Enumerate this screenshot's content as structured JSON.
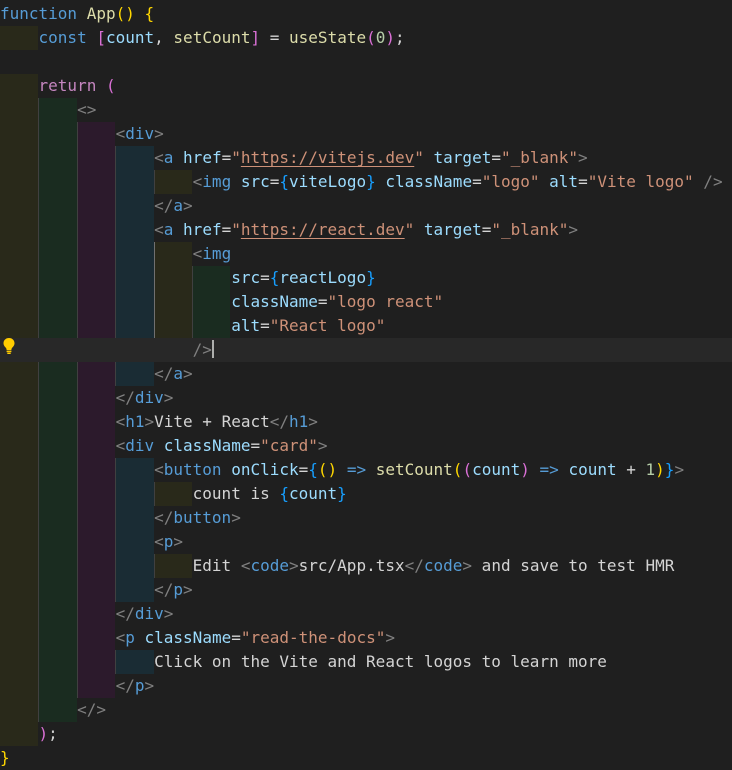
{
  "colors": {
    "keyword": "#c586c0",
    "storage": "#569cd6",
    "function": "#dcdcaa",
    "variable": "#9cdcfe",
    "number": "#b5cea8",
    "string": "#ce9178",
    "tag": "#569cd6",
    "tag_punct": "#808080",
    "attr": "#9cdcfe",
    "text": "#d4d4d4",
    "bracket1": "#ffd700",
    "bracket2": "#da70d6",
    "bracket3": "#179fff",
    "url": "#ce9178"
  },
  "lightbulb_icon": "lightbulb",
  "lines": [
    [
      {
        "t": "function ",
        "c": "storage"
      },
      {
        "t": "App",
        "c": "function"
      },
      {
        "t": "()",
        "c": "bracket1"
      },
      {
        "t": " ",
        "c": "text"
      },
      {
        "t": "{",
        "c": "bracket1"
      }
    ],
    [
      {
        "t": "    ",
        "c": "text"
      },
      {
        "t": "const",
        "c": "storage"
      },
      {
        "t": " ",
        "c": "text"
      },
      {
        "t": "[",
        "c": "bracket2"
      },
      {
        "t": "count",
        "c": "variable"
      },
      {
        "t": ", ",
        "c": "text"
      },
      {
        "t": "setCount",
        "c": "function"
      },
      {
        "t": "]",
        "c": "bracket2"
      },
      {
        "t": " = ",
        "c": "text"
      },
      {
        "t": "useState",
        "c": "function"
      },
      {
        "t": "(",
        "c": "bracket2"
      },
      {
        "t": "0",
        "c": "number"
      },
      {
        "t": ")",
        "c": "bracket2"
      },
      {
        "t": ";",
        "c": "text"
      }
    ],
    [],
    [
      {
        "t": "    ",
        "c": "text"
      },
      {
        "t": "return",
        "c": "keyword"
      },
      {
        "t": " ",
        "c": "text"
      },
      {
        "t": "(",
        "c": "bracket2"
      }
    ],
    [
      {
        "t": "        ",
        "c": "text"
      },
      {
        "t": "<>",
        "c": "tag_punct"
      }
    ],
    [
      {
        "t": "            ",
        "c": "text"
      },
      {
        "t": "<",
        "c": "tag_punct"
      },
      {
        "t": "div",
        "c": "tag"
      },
      {
        "t": ">",
        "c": "tag_punct"
      }
    ],
    [
      {
        "t": "                ",
        "c": "text"
      },
      {
        "t": "<",
        "c": "tag_punct"
      },
      {
        "t": "a",
        "c": "tag"
      },
      {
        "t": " ",
        "c": "text"
      },
      {
        "t": "href",
        "c": "attr"
      },
      {
        "t": "=",
        "c": "text"
      },
      {
        "t": "\"",
        "c": "string"
      },
      {
        "t": "https://vitejs.dev",
        "c": "url"
      },
      {
        "t": "\"",
        "c": "string"
      },
      {
        "t": " ",
        "c": "text"
      },
      {
        "t": "target",
        "c": "attr"
      },
      {
        "t": "=",
        "c": "text"
      },
      {
        "t": "\"_blank\"",
        "c": "string"
      },
      {
        "t": ">",
        "c": "tag_punct"
      }
    ],
    [
      {
        "t": "                    ",
        "c": "text"
      },
      {
        "t": "<",
        "c": "tag_punct"
      },
      {
        "t": "img",
        "c": "tag"
      },
      {
        "t": " ",
        "c": "text"
      },
      {
        "t": "src",
        "c": "attr"
      },
      {
        "t": "=",
        "c": "text"
      },
      {
        "t": "{",
        "c": "bracket3"
      },
      {
        "t": "viteLogo",
        "c": "variable"
      },
      {
        "t": "}",
        "c": "bracket3"
      },
      {
        "t": " ",
        "c": "text"
      },
      {
        "t": "className",
        "c": "attr"
      },
      {
        "t": "=",
        "c": "text"
      },
      {
        "t": "\"logo\"",
        "c": "string"
      },
      {
        "t": " ",
        "c": "text"
      },
      {
        "t": "alt",
        "c": "attr"
      },
      {
        "t": "=",
        "c": "text"
      },
      {
        "t": "\"Vite logo\"",
        "c": "string"
      },
      {
        "t": " />",
        "c": "tag_punct"
      }
    ],
    [
      {
        "t": "                ",
        "c": "text"
      },
      {
        "t": "</",
        "c": "tag_punct"
      },
      {
        "t": "a",
        "c": "tag"
      },
      {
        "t": ">",
        "c": "tag_punct"
      }
    ],
    [
      {
        "t": "                ",
        "c": "text"
      },
      {
        "t": "<",
        "c": "tag_punct"
      },
      {
        "t": "a",
        "c": "tag"
      },
      {
        "t": " ",
        "c": "text"
      },
      {
        "t": "href",
        "c": "attr"
      },
      {
        "t": "=",
        "c": "text"
      },
      {
        "t": "\"",
        "c": "string"
      },
      {
        "t": "https://react.dev",
        "c": "url"
      },
      {
        "t": "\"",
        "c": "string"
      },
      {
        "t": " ",
        "c": "text"
      },
      {
        "t": "target",
        "c": "attr"
      },
      {
        "t": "=",
        "c": "text"
      },
      {
        "t": "\"_blank\"",
        "c": "string"
      },
      {
        "t": ">",
        "c": "tag_punct"
      }
    ],
    [
      {
        "t": "                    ",
        "c": "text"
      },
      {
        "t": "<",
        "c": "tag_punct"
      },
      {
        "t": "img",
        "c": "tag"
      }
    ],
    [
      {
        "t": "                        ",
        "c": "text"
      },
      {
        "t": "src",
        "c": "attr"
      },
      {
        "t": "=",
        "c": "text"
      },
      {
        "t": "{",
        "c": "bracket3"
      },
      {
        "t": "reactLogo",
        "c": "variable"
      },
      {
        "t": "}",
        "c": "bracket3"
      }
    ],
    [
      {
        "t": "                        ",
        "c": "text"
      },
      {
        "t": "className",
        "c": "attr"
      },
      {
        "t": "=",
        "c": "text"
      },
      {
        "t": "\"logo react\"",
        "c": "string"
      }
    ],
    [
      {
        "t": "                        ",
        "c": "text"
      },
      {
        "t": "alt",
        "c": "attr"
      },
      {
        "t": "=",
        "c": "text"
      },
      {
        "t": "\"React logo\"",
        "c": "string"
      }
    ],
    [
      {
        "t": "                    ",
        "c": "text"
      },
      {
        "t": "/>",
        "c": "tag_punct"
      }
    ],
    [
      {
        "t": "                ",
        "c": "text"
      },
      {
        "t": "</",
        "c": "tag_punct"
      },
      {
        "t": "a",
        "c": "tag"
      },
      {
        "t": ">",
        "c": "tag_punct"
      }
    ],
    [
      {
        "t": "            ",
        "c": "text"
      },
      {
        "t": "</",
        "c": "tag_punct"
      },
      {
        "t": "div",
        "c": "tag"
      },
      {
        "t": ">",
        "c": "tag_punct"
      }
    ],
    [
      {
        "t": "            ",
        "c": "text"
      },
      {
        "t": "<",
        "c": "tag_punct"
      },
      {
        "t": "h1",
        "c": "tag"
      },
      {
        "t": ">",
        "c": "tag_punct"
      },
      {
        "t": "Vite + React",
        "c": "text"
      },
      {
        "t": "</",
        "c": "tag_punct"
      },
      {
        "t": "h1",
        "c": "tag"
      },
      {
        "t": ">",
        "c": "tag_punct"
      }
    ],
    [
      {
        "t": "            ",
        "c": "text"
      },
      {
        "t": "<",
        "c": "tag_punct"
      },
      {
        "t": "div",
        "c": "tag"
      },
      {
        "t": " ",
        "c": "text"
      },
      {
        "t": "className",
        "c": "attr"
      },
      {
        "t": "=",
        "c": "text"
      },
      {
        "t": "\"card\"",
        "c": "string"
      },
      {
        "t": ">",
        "c": "tag_punct"
      }
    ],
    [
      {
        "t": "                ",
        "c": "text"
      },
      {
        "t": "<",
        "c": "tag_punct"
      },
      {
        "t": "button",
        "c": "tag"
      },
      {
        "t": " ",
        "c": "text"
      },
      {
        "t": "onClick",
        "c": "attr"
      },
      {
        "t": "=",
        "c": "text"
      },
      {
        "t": "{",
        "c": "bracket3"
      },
      {
        "t": "()",
        "c": "bracket1"
      },
      {
        "t": " ",
        "c": "text"
      },
      {
        "t": "=>",
        "c": "storage"
      },
      {
        "t": " ",
        "c": "text"
      },
      {
        "t": "setCount",
        "c": "function"
      },
      {
        "t": "(",
        "c": "bracket1"
      },
      {
        "t": "(",
        "c": "bracket2"
      },
      {
        "t": "count",
        "c": "variable"
      },
      {
        "t": ")",
        "c": "bracket2"
      },
      {
        "t": " ",
        "c": "text"
      },
      {
        "t": "=>",
        "c": "storage"
      },
      {
        "t": " ",
        "c": "text"
      },
      {
        "t": "count",
        "c": "variable"
      },
      {
        "t": " + ",
        "c": "text"
      },
      {
        "t": "1",
        "c": "number"
      },
      {
        "t": ")",
        "c": "bracket1"
      },
      {
        "t": "}",
        "c": "bracket3"
      },
      {
        "t": ">",
        "c": "tag_punct"
      }
    ],
    [
      {
        "t": "                    ",
        "c": "text"
      },
      {
        "t": "count is ",
        "c": "text"
      },
      {
        "t": "{",
        "c": "bracket3"
      },
      {
        "t": "count",
        "c": "variable"
      },
      {
        "t": "}",
        "c": "bracket3"
      }
    ],
    [
      {
        "t": "                ",
        "c": "text"
      },
      {
        "t": "</",
        "c": "tag_punct"
      },
      {
        "t": "button",
        "c": "tag"
      },
      {
        "t": ">",
        "c": "tag_punct"
      }
    ],
    [
      {
        "t": "                ",
        "c": "text"
      },
      {
        "t": "<",
        "c": "tag_punct"
      },
      {
        "t": "p",
        "c": "tag"
      },
      {
        "t": ">",
        "c": "tag_punct"
      }
    ],
    [
      {
        "t": "                    ",
        "c": "text"
      },
      {
        "t": "Edit ",
        "c": "text"
      },
      {
        "t": "<",
        "c": "tag_punct"
      },
      {
        "t": "code",
        "c": "tag"
      },
      {
        "t": ">",
        "c": "tag_punct"
      },
      {
        "t": "src/App.tsx",
        "c": "text"
      },
      {
        "t": "</",
        "c": "tag_punct"
      },
      {
        "t": "code",
        "c": "tag"
      },
      {
        "t": ">",
        "c": "tag_punct"
      },
      {
        "t": " and save to test HMR",
        "c": "text"
      }
    ],
    [
      {
        "t": "                ",
        "c": "text"
      },
      {
        "t": "</",
        "c": "tag_punct"
      },
      {
        "t": "p",
        "c": "tag"
      },
      {
        "t": ">",
        "c": "tag_punct"
      }
    ],
    [
      {
        "t": "            ",
        "c": "text"
      },
      {
        "t": "</",
        "c": "tag_punct"
      },
      {
        "t": "div",
        "c": "tag"
      },
      {
        "t": ">",
        "c": "tag_punct"
      }
    ],
    [
      {
        "t": "            ",
        "c": "text"
      },
      {
        "t": "<",
        "c": "tag_punct"
      },
      {
        "t": "p",
        "c": "tag"
      },
      {
        "t": " ",
        "c": "text"
      },
      {
        "t": "className",
        "c": "attr"
      },
      {
        "t": "=",
        "c": "text"
      },
      {
        "t": "\"read-the-docs\"",
        "c": "string"
      },
      {
        "t": ">",
        "c": "tag_punct"
      }
    ],
    [
      {
        "t": "                ",
        "c": "text"
      },
      {
        "t": "Click on the Vite and React logos to learn more",
        "c": "text"
      }
    ],
    [
      {
        "t": "            ",
        "c": "text"
      },
      {
        "t": "</",
        "c": "tag_punct"
      },
      {
        "t": "p",
        "c": "tag"
      },
      {
        "t": ">",
        "c": "tag_punct"
      }
    ],
    [
      {
        "t": "        ",
        "c": "text"
      },
      {
        "t": "</>",
        "c": "tag_punct"
      }
    ],
    [
      {
        "t": "    ",
        "c": "text"
      },
      {
        "t": ")",
        "c": "bracket2"
      },
      {
        "t": ";",
        "c": "text"
      }
    ],
    [
      {
        "t": "}",
        "c": "bracket1"
      }
    ]
  ]
}
